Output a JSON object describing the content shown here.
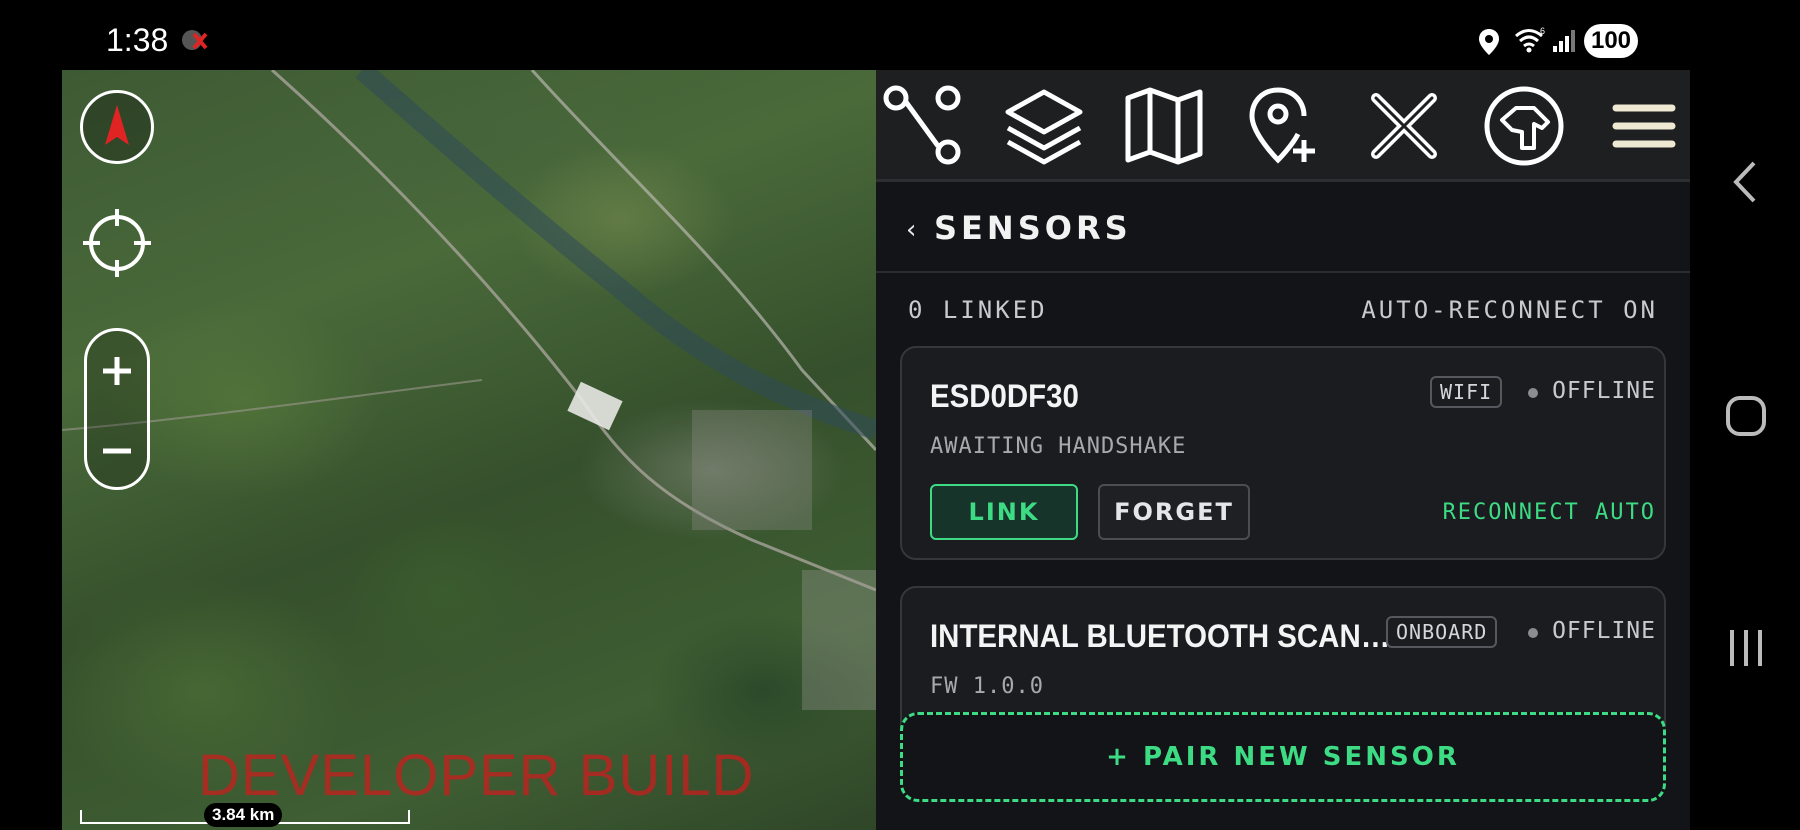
{
  "status_bar": {
    "time": "1:38",
    "battery": "100",
    "icons": [
      "app-notification-icon",
      "location-icon",
      "wifi-6-icon",
      "signal-icon"
    ]
  },
  "map": {
    "watermark": "DEVELOPER BUILD",
    "scale_label": "3.84 km",
    "controls": [
      "compass-icon",
      "locate-icon",
      "zoom-in-icon",
      "zoom-out-icon"
    ]
  },
  "toolbar": {
    "tools": [
      "route-icon",
      "layers-icon",
      "map-icon",
      "add-pin-icon",
      "close-icon",
      "dog-tracker-icon",
      "menu-icon"
    ]
  },
  "panel": {
    "back_label": "‹",
    "title": "SENSORS",
    "linked_count": "0 LINKED",
    "auto_reconnect": "AUTO-RECONNECT ON",
    "sensors": [
      {
        "name": "ESD0DF30",
        "type_badge": "WIFI",
        "status": "OFFLINE",
        "subtitle": "AWAITING HANDSHAKE",
        "link_label": "LINK",
        "forget_label": "FORGET",
        "reconnect_label": "RECONNECT AUTO"
      },
      {
        "name": "INTERNAL BLUETOOTH SCAN…",
        "type_badge": "ONBOARD",
        "status": "OFFLINE",
        "subtitle": "FW 1.0.0"
      }
    ],
    "pair_button": "+ PAIR NEW SENSOR"
  },
  "colors": {
    "accent_green": "#3ddc84",
    "panel_bg": "#121417",
    "card_bg": "#1a1c20",
    "watermark_red": "#c81e1e"
  },
  "nav_bar": {
    "buttons": [
      "back-icon",
      "home-icon",
      "recents-icon"
    ]
  }
}
